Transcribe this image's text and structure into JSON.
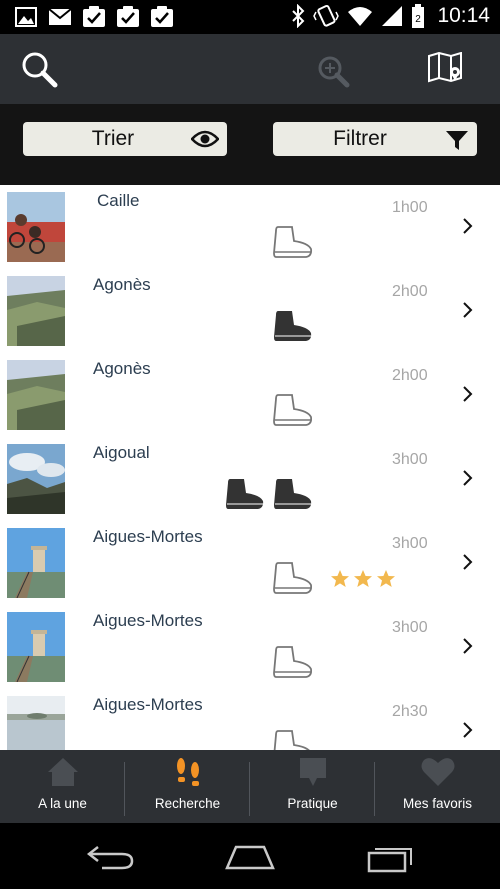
{
  "status_bar": {
    "time": "10:14",
    "left_icons": [
      "image-icon",
      "mail-icon",
      "check-icon",
      "check-icon",
      "check-icon"
    ],
    "right_icons": [
      "bluetooth-icon",
      "vibrate-icon",
      "wifi-icon",
      "signal-icon",
      "battery-icon"
    ]
  },
  "toolbar": {
    "icons": [
      "search-icon",
      "zoom-in-icon",
      "map-icon"
    ]
  },
  "actions": {
    "sort_label": "Trier",
    "filter_label": "Filtrer"
  },
  "trails": [
    {
      "name": "Caille",
      "duration": "1h00",
      "difficulty": 1,
      "difficulty_filled": false,
      "rating": 0
    },
    {
      "name": "Agonès",
      "duration": "2h00",
      "difficulty": 1,
      "difficulty_filled": true,
      "rating": 0
    },
    {
      "name": "Agonès",
      "duration": "2h00",
      "difficulty": 1,
      "difficulty_filled": false,
      "rating": 0
    },
    {
      "name": "Aigoual",
      "duration": "3h00",
      "difficulty": 2,
      "difficulty_filled": true,
      "rating": 0
    },
    {
      "name": "Aigues-Mortes",
      "duration": "3h00",
      "difficulty": 1,
      "difficulty_filled": false,
      "rating": 3
    },
    {
      "name": "Aigues-Mortes",
      "duration": "3h00",
      "difficulty": 1,
      "difficulty_filled": false,
      "rating": 0
    },
    {
      "name": "Aigues-Mortes",
      "duration": "2h30",
      "difficulty": 1,
      "difficulty_filled": false,
      "rating": 0
    }
  ],
  "tabs": [
    {
      "label": "A la une",
      "icon": "home-icon"
    },
    {
      "label": "Recherche",
      "icon": "footsteps-icon",
      "active": true
    },
    {
      "label": "Pratique",
      "icon": "speech-bubble-icon"
    },
    {
      "label": "Mes favoris",
      "icon": "heart-icon"
    }
  ],
  "colors": {
    "toolbar_bg": "#2d3034",
    "active_tab": "#f39325",
    "star": "#f2b84e",
    "name_text": "#2c3e50",
    "duration_text": "#a6a6a6"
  }
}
